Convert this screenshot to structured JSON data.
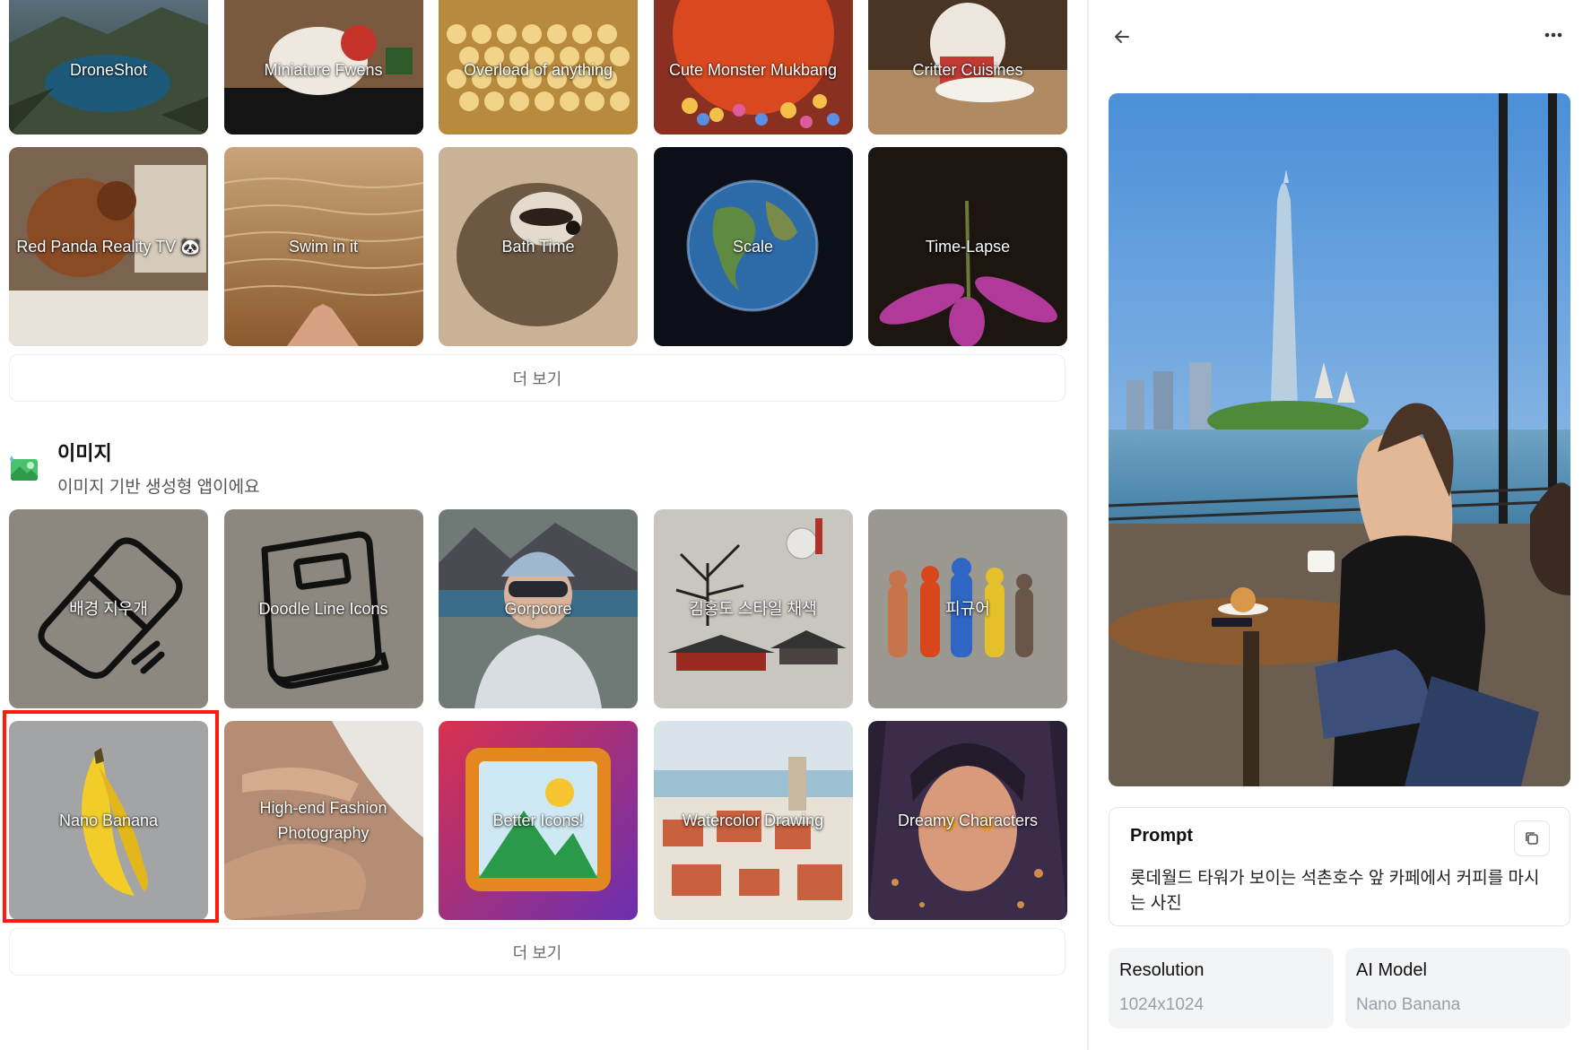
{
  "feed": {
    "video_cards": [
      {
        "label": "DroneShot"
      },
      {
        "label": "Miniature Fwens"
      },
      {
        "label": "Overload of anything"
      },
      {
        "label": "Cute Monster Mukbang"
      },
      {
        "label": "Critter Cuisines"
      },
      {
        "label": "Red Panda Reality TV 🐼"
      },
      {
        "label": "Swim in it"
      },
      {
        "label": "Bath Time"
      },
      {
        "label": "Scale"
      },
      {
        "label": "Time-Lapse"
      }
    ],
    "more_label": "더 보기",
    "image_section": {
      "title": "이미지",
      "subtitle": "이미지 기반 생성형 앱이에요",
      "icon": "image-icon"
    },
    "image_cards": [
      {
        "label": "배경 지우개"
      },
      {
        "label": "Doodle Line Icons"
      },
      {
        "label": "Gorpcore"
      },
      {
        "label": "김홍도 스타일 채색"
      },
      {
        "label": "피규어"
      },
      {
        "label": "Nano Banana"
      },
      {
        "label": "High-end Fashion Photography"
      },
      {
        "label": "Better Icons!"
      },
      {
        "label": "Watercolor Drawing"
      },
      {
        "label": "Dreamy Characters"
      }
    ],
    "more_label_2": "더 보기",
    "highlight_color": "#ff1a0a"
  },
  "panel": {
    "back_icon": "arrow-left-icon",
    "menu_icon": "more-horizontal-icon",
    "prompt": {
      "title": "Prompt",
      "text": "롯데월드 타워가 보이는 석촌호수 앞 카페에서 커피를 마시는 사진",
      "copy_icon": "copy-icon"
    },
    "resolution": {
      "label": "Resolution",
      "value": "1024x1024"
    },
    "model": {
      "label": "AI Model",
      "value": "Nano Banana"
    }
  }
}
